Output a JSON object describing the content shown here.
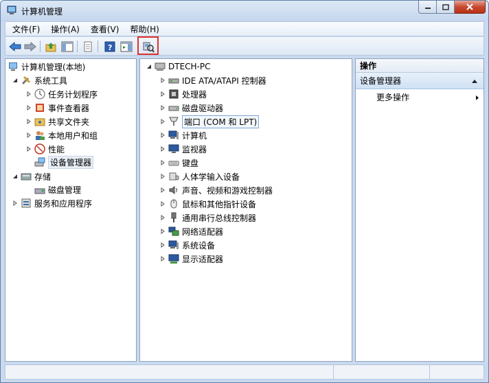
{
  "window": {
    "title": "计算机管理",
    "controls": {
      "minimize_icon": "minimize-icon",
      "maximize_icon": "maximize-icon",
      "close_icon": "close-icon"
    }
  },
  "menu": [
    "文件(F)",
    "操作(A)",
    "查看(V)",
    "帮助(H)"
  ],
  "toolbar": {
    "buttons": [
      "back-arrow-icon",
      "forward-arrow-icon",
      "up-folder-icon",
      "show-hide-tree-icon",
      "export-list-icon",
      "help-icon",
      "show-hide-action-icon",
      "scan-hardware-icon"
    ],
    "highlighted": "scan-hardware-icon",
    "highlight_color": "#e03030"
  },
  "left_tree": {
    "root": "计算机管理(本地)",
    "system_tools": "系统工具",
    "system_children": [
      "任务计划程序",
      "事件查看器",
      "共享文件夹",
      "本地用户和组",
      "性能",
      "设备管理器"
    ],
    "storage": "存储",
    "storage_children": [
      "磁盘管理"
    ],
    "services": "服务和应用程序",
    "selected": "设备管理器"
  },
  "device_tree": {
    "root": "DTECH-PC",
    "categories": [
      "IDE ATA/ATAPI 控制器",
      "处理器",
      "磁盘驱动器",
      "端口 (COM 和 LPT)",
      "计算机",
      "监视器",
      "键盘",
      "人体学输入设备",
      "声音、视频和游戏控制器",
      "鼠标和其他指针设备",
      "通用串行总线控制器",
      "网络适配器",
      "系统设备",
      "显示适配器"
    ],
    "selected": "端口 (COM 和 LPT)"
  },
  "actions": {
    "header": "操作",
    "section": "设备管理器",
    "more": "更多操作"
  },
  "colors": {
    "title_bg": "#c9d9ee",
    "close_red": "#c7492f",
    "selection_blue": "#cfe1f5"
  }
}
